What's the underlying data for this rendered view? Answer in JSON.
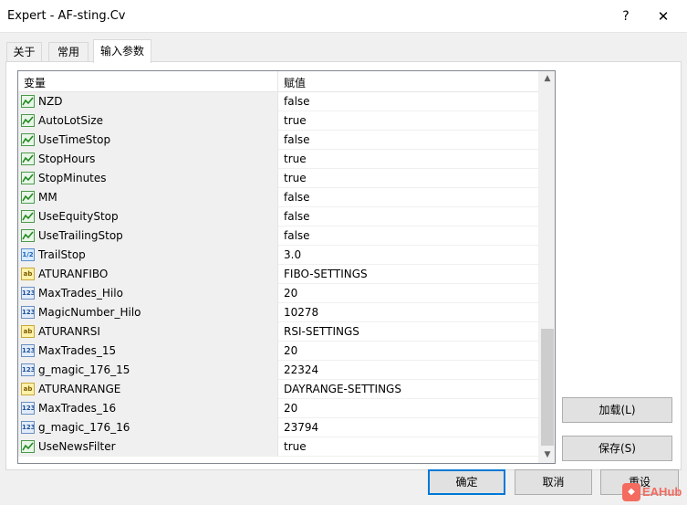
{
  "window": {
    "title": "Expert - AF-sting.Cv",
    "help_glyph": "?",
    "close_glyph": "✕"
  },
  "tabs": [
    {
      "label": "关于"
    },
    {
      "label": "常用"
    },
    {
      "label": "输入参数",
      "active": true
    }
  ],
  "grid": {
    "col_variable": "变量",
    "col_value": "赋值",
    "rows": [
      {
        "icon": "bool",
        "name": "NZD",
        "value": "false"
      },
      {
        "icon": "bool",
        "name": "AutoLotSize",
        "value": "true"
      },
      {
        "icon": "bool",
        "name": "UseTimeStop",
        "value": "false"
      },
      {
        "icon": "bool",
        "name": "StopHours",
        "value": "true"
      },
      {
        "icon": "bool",
        "name": "StopMinutes",
        "value": "true"
      },
      {
        "icon": "bool",
        "name": "MM",
        "value": "false"
      },
      {
        "icon": "bool",
        "name": "UseEquityStop",
        "value": "false"
      },
      {
        "icon": "bool",
        "name": "UseTrailingStop",
        "value": "false"
      },
      {
        "icon": "dbl",
        "name": "TrailStop",
        "value": "3.0"
      },
      {
        "icon": "str",
        "name": "ATURANFIBO",
        "value": "FIBO-SETTINGS"
      },
      {
        "icon": "int",
        "name": "MaxTrades_Hilo",
        "value": "20"
      },
      {
        "icon": "int",
        "name": "MagicNumber_Hilo",
        "value": "10278"
      },
      {
        "icon": "str",
        "name": "ATURANRSI",
        "value": "RSI-SETTINGS"
      },
      {
        "icon": "int",
        "name": "MaxTrades_15",
        "value": "20"
      },
      {
        "icon": "int",
        "name": "g_magic_176_15",
        "value": "22324"
      },
      {
        "icon": "str",
        "name": "ATURANRANGE",
        "value": "DAYRANGE-SETTINGS"
      },
      {
        "icon": "int",
        "name": "MaxTrades_16",
        "value": "20"
      },
      {
        "icon": "int",
        "name": "g_magic_176_16",
        "value": "23794"
      },
      {
        "icon": "bool",
        "name": "UseNewsFilter",
        "value": "true"
      }
    ]
  },
  "icon_text": {
    "dbl": "1/2",
    "str": "ab",
    "int": "123"
  },
  "side_buttons": {
    "load": "加载(L)",
    "save": "保存(S)"
  },
  "bottom_buttons": {
    "ok": "确定",
    "cancel": "取消",
    "reset": "重设"
  },
  "watermark": {
    "text": "EAHub"
  }
}
